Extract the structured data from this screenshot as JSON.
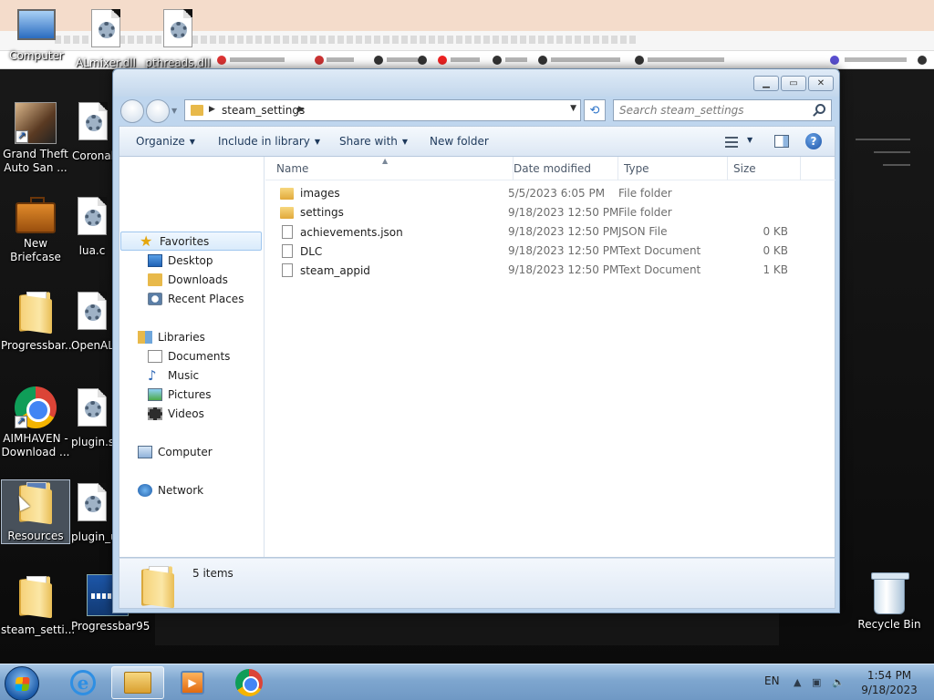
{
  "desktop": {
    "icons": [
      {
        "label": "Computer"
      },
      {
        "label": "ALmixer.dll"
      },
      {
        "label": "pthreads.dll"
      },
      {
        "label": "Grand Theft Auto San ..."
      },
      {
        "label": "Coronal"
      },
      {
        "label": "New Briefcase"
      },
      {
        "label": "lua.c"
      },
      {
        "label": "Progressbar..."
      },
      {
        "label": "OpenAL"
      },
      {
        "label": "AIMHAVEN - Download ..."
      },
      {
        "label": "plugin.s"
      },
      {
        "label": "Resources"
      },
      {
        "label": "plugin_u"
      },
      {
        "label": "steam_setti..."
      },
      {
        "label": "Progressbar95"
      },
      {
        "label": "Recycle Bin"
      }
    ]
  },
  "window": {
    "address_crumb": "steam_settings",
    "search_placeholder": "Search steam_settings",
    "toolbar": {
      "organize": "Organize",
      "include_in_library": "Include in library",
      "share_with": "Share with",
      "new_folder": "New folder"
    },
    "navpane": {
      "favorites": "Favorites",
      "desktop": "Desktop",
      "downloads": "Downloads",
      "recent_places": "Recent Places",
      "libraries": "Libraries",
      "documents": "Documents",
      "music": "Music",
      "pictures": "Pictures",
      "videos": "Videos",
      "computer": "Computer",
      "network": "Network"
    },
    "columns": {
      "name": "Name",
      "date_modified": "Date modified",
      "type": "Type",
      "size": "Size"
    },
    "files": [
      {
        "name": "images",
        "date": "5/5/2023 6:05 PM",
        "type": "File folder",
        "size": "",
        "icon": "folder-icon"
      },
      {
        "name": "settings",
        "date": "9/18/2023 12:50 PM",
        "type": "File folder",
        "size": "",
        "icon": "folder-icon"
      },
      {
        "name": "achievements.json",
        "date": "9/18/2023 12:50 PM",
        "type": "JSON File",
        "size": "0 KB",
        "icon": "file-icon"
      },
      {
        "name": "DLC",
        "date": "9/18/2023 12:50 PM",
        "type": "Text Document",
        "size": "0 KB",
        "icon": "file-icon"
      },
      {
        "name": "steam_appid",
        "date": "9/18/2023 12:50 PM",
        "type": "Text Document",
        "size": "1 KB",
        "icon": "file-icon"
      }
    ],
    "item_count": "5 items"
  },
  "taskbar": {
    "language": "EN",
    "time": "1:54 PM",
    "date": "9/18/2023"
  }
}
